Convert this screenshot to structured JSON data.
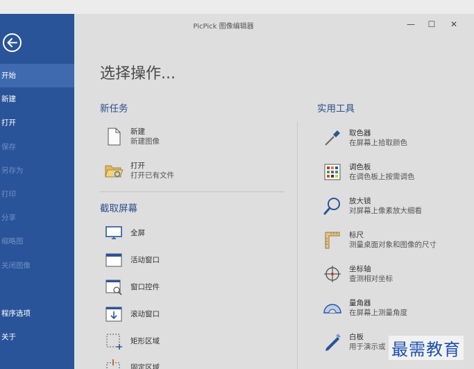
{
  "window": {
    "title": "PicPick 图像编辑器",
    "minimize": "—",
    "maximize": "☐",
    "close": "✕"
  },
  "sidebar": {
    "items": [
      {
        "label": "开始",
        "state": "active"
      },
      {
        "label": "新建",
        "state": "normal"
      },
      {
        "label": "打开",
        "state": "normal"
      },
      {
        "label": "保存",
        "state": "disabled"
      },
      {
        "label": "另存为",
        "state": "disabled"
      },
      {
        "label": "打印",
        "state": "disabled"
      },
      {
        "label": "分享",
        "state": "disabled"
      },
      {
        "label": "缩略图",
        "state": "disabled"
      },
      {
        "label": "关闭图像",
        "state": "disabled"
      }
    ],
    "lower_items": [
      {
        "label": "程序选项"
      },
      {
        "label": "关于"
      }
    ]
  },
  "main": {
    "heading": "选择操作...",
    "new_task": {
      "title": "新任务",
      "items": [
        {
          "label": "新建",
          "desc": "新建图像",
          "icon": "new-document-icon"
        },
        {
          "label": "打开",
          "desc": "打开已有文件",
          "icon": "open-folder-icon"
        }
      ]
    },
    "capture": {
      "title": "截取屏幕",
      "items": [
        {
          "label": "全屏",
          "icon": "monitor-icon"
        },
        {
          "label": "活动窗口",
          "icon": "active-window-icon"
        },
        {
          "label": "窗口控件",
          "icon": "window-control-icon"
        },
        {
          "label": "滚动窗口",
          "icon": "scroll-window-icon"
        },
        {
          "label": "矩形区域",
          "icon": "rectangle-region-icon"
        },
        {
          "label": "固定区域",
          "icon": "fixed-region-icon"
        }
      ]
    },
    "tools": {
      "title": "实用工具",
      "items": [
        {
          "label": "取色器",
          "desc": "在屏幕上拾取颜色",
          "icon": "eyedropper-icon"
        },
        {
          "label": "调色板",
          "desc": "在调色板上按需调色",
          "icon": "palette-icon"
        },
        {
          "label": "放大镜",
          "desc": "对屏幕上像素放大细看",
          "icon": "magnifier-icon"
        },
        {
          "label": "标尺",
          "desc": "测量桌面对象和图像的尺寸",
          "icon": "ruler-icon"
        },
        {
          "label": "坐标轴",
          "desc": "查测相对坐标",
          "icon": "crosshair-icon"
        },
        {
          "label": "量角器",
          "desc": "在屏幕上测量角度",
          "icon": "protractor-icon"
        },
        {
          "label": "白板",
          "desc": "用于演示或",
          "icon": "whiteboard-pen-icon"
        }
      ]
    }
  },
  "watermark": {
    "text": "最需教育"
  },
  "colors": {
    "sidebar": "#2a5499",
    "sidebar_active": "#3f6ab0",
    "accent_text": "#2b4f8c",
    "watermark": "#1c4fb0"
  }
}
